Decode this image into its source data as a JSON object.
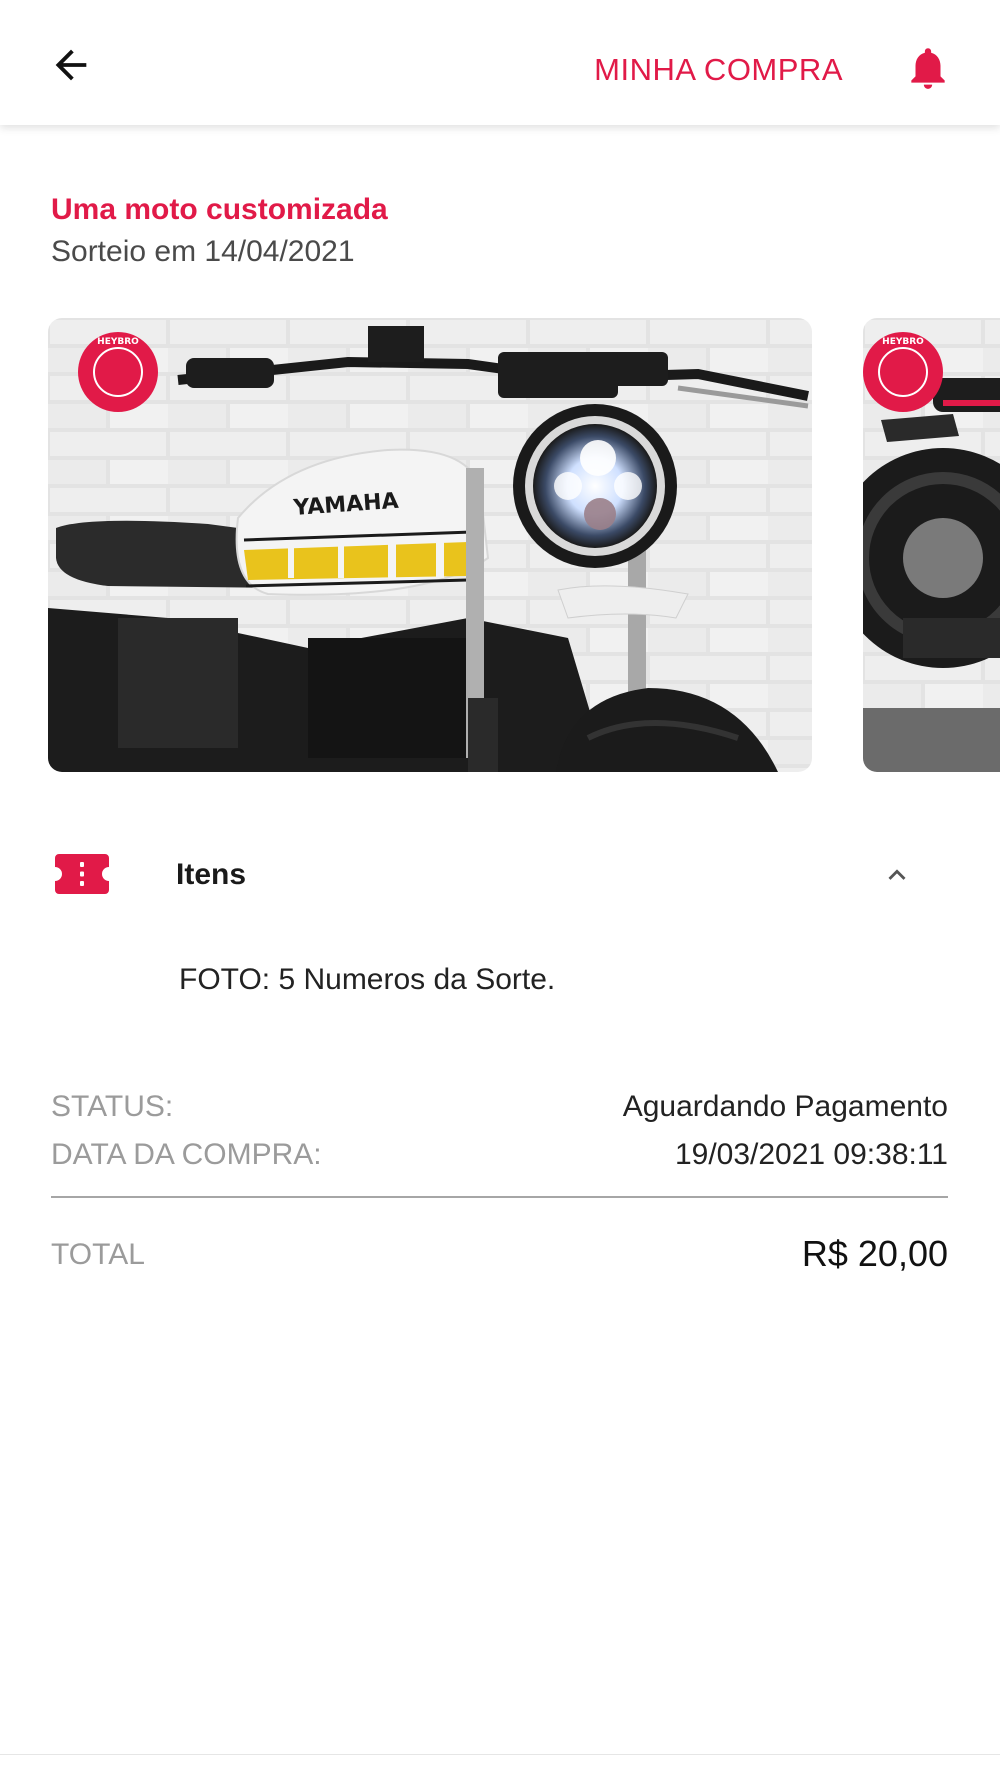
{
  "header": {
    "title": "MINHA COMPRA",
    "back_icon": "arrow-left-icon",
    "bell_icon": "bell-icon",
    "accent_color": "#e11a48"
  },
  "raffle": {
    "title": "Uma moto customizada",
    "date_text": "Sorteio em 14/04/2021"
  },
  "carousel": {
    "slides": [
      {
        "badge": "HEYBRO",
        "brand": "YAMAHA"
      },
      {
        "badge": "HEYBRO"
      }
    ]
  },
  "items": {
    "label": "Itens",
    "icon": "ticket-icon",
    "expanded_icon": "chevron-up-icon",
    "entries": [
      "FOTO: 5 Numeros da Sorte."
    ]
  },
  "details": {
    "status_label": "STATUS:",
    "status_value": "Aguardando Pagamento",
    "date_label": "DATA DA COMPRA:",
    "date_value": "19/03/2021 09:38:11",
    "total_label": "TOTAL",
    "total_value": "R$ 20,00"
  }
}
